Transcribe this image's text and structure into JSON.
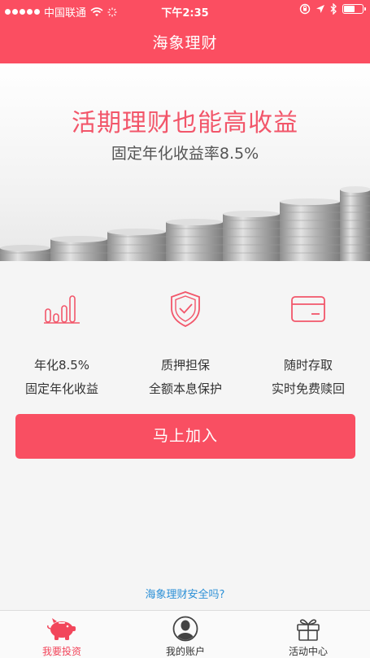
{
  "status_bar": {
    "carrier": "中国联通",
    "time": "下午2:35"
  },
  "nav": {
    "title": "海象理财"
  },
  "hero": {
    "title": "活期理财也能高收益",
    "subtitle": "固定年化收益率8.5%"
  },
  "features": [
    {
      "icon": "bar-chart-icon",
      "line1": "年化8.5%",
      "line2": "固定年化收益"
    },
    {
      "icon": "shield-check-icon",
      "line1": "质押担保",
      "line2": "全额本息保护"
    },
    {
      "icon": "card-icon",
      "line1": "随时存取",
      "line2": "实时免费赎回"
    }
  ],
  "join_button": {
    "label": "马上加入"
  },
  "safety_link": {
    "label": "海象理财安全吗?"
  },
  "tabs": [
    {
      "icon": "piggy-bank-icon",
      "label": "我要投资",
      "active": true
    },
    {
      "icon": "user-icon",
      "label": "我的账户",
      "active": false
    },
    {
      "icon": "gift-icon",
      "label": "活动中心",
      "active": false
    }
  ],
  "colors": {
    "brand": "#fb4e61",
    "link": "#2a8fd6"
  }
}
